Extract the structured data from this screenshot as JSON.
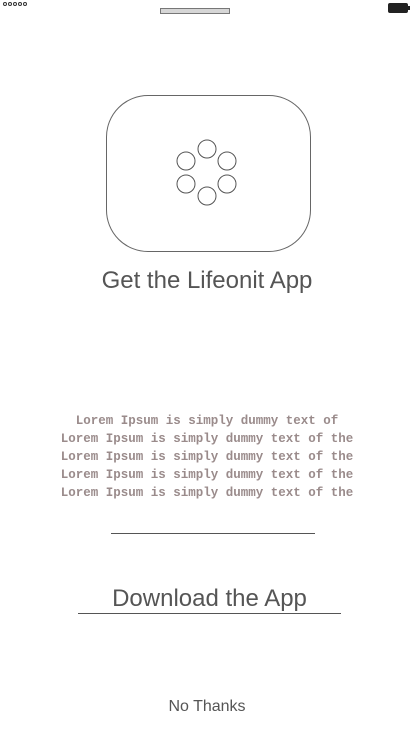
{
  "status_bar": {
    "signal_icon": "signal-dots-icon",
    "battery_icon": "battery-icon"
  },
  "app_icon": {
    "icon": "app-logo-icon"
  },
  "title": "Get the Lifeonit App",
  "description": {
    "lines": [
      "Lorem Ipsum is simply dummy text of",
      "Lorem Ipsum is simply dummy text of the",
      "Lorem Ipsum is simply dummy text of the",
      "Lorem Ipsum is simply dummy text of the",
      "Lorem Ipsum is simply dummy text of the"
    ]
  },
  "buttons": {
    "download_label": "Download the App",
    "no_thanks_label": "No Thanks"
  }
}
